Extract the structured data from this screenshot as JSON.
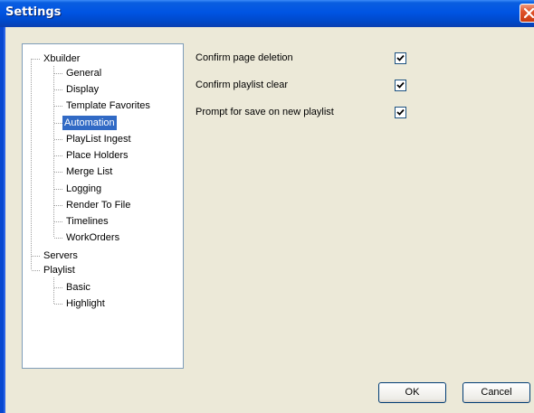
{
  "window": {
    "title": "Settings"
  },
  "tree": {
    "root": "Xbuilder",
    "xbuilder_children": [
      "General",
      "Display",
      "Template Favorites",
      "Automation",
      "PlayList Ingest",
      "Place Holders",
      "Merge List",
      "Logging",
      "Render To File",
      "Timelines",
      "WorkOrders"
    ],
    "servers": "Servers",
    "playlist": "Playlist",
    "playlist_children": [
      "Basic",
      "Highlight"
    ],
    "selected": "Automation"
  },
  "options": [
    {
      "label": "Confirm page deletion",
      "checked": true
    },
    {
      "label": "Confirm playlist clear",
      "checked": true
    },
    {
      "label": "Prompt for save on new playlist",
      "checked": true
    }
  ],
  "buttons": {
    "ok": "OK",
    "cancel": "Cancel"
  }
}
